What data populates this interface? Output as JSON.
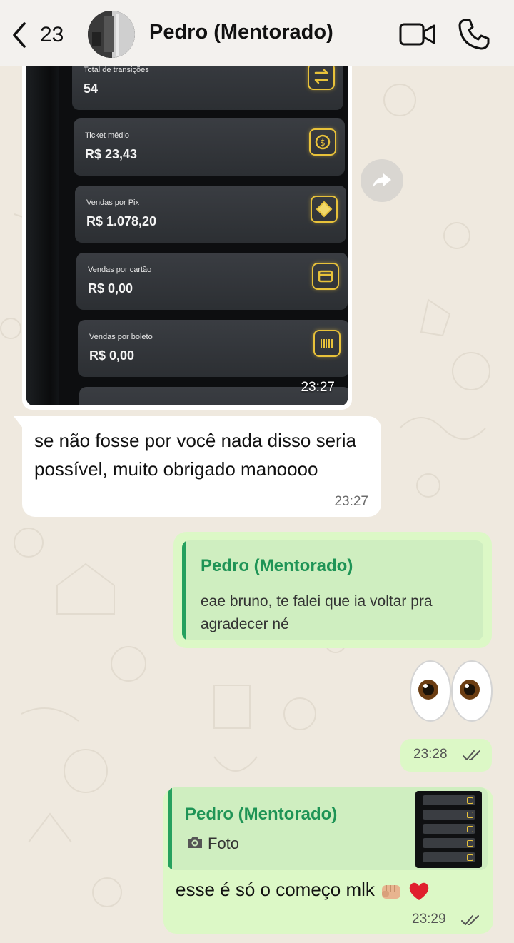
{
  "header": {
    "back_count": "23",
    "title": "Pedro (Mentorado)",
    "icons": [
      "chevron-left-icon",
      "avatar",
      "video-camera-icon",
      "phone-icon"
    ]
  },
  "photo_message": {
    "stats": [
      {
        "label": "Total de transições",
        "value": "54",
        "icon": "swap-arrows-icon"
      },
      {
        "label": "Ticket médio",
        "value": "R$ 23,43",
        "icon": "coin-icon"
      },
      {
        "label": "Vendas por Pix",
        "value": "R$ 1.078,20",
        "icon": "pix-icon"
      },
      {
        "label": "Vendas por cartão",
        "value": "R$ 0,00",
        "icon": "card-icon"
      },
      {
        "label": "Vendas por boleto",
        "value": "R$ 0,00",
        "icon": "barcode-icon"
      }
    ],
    "time": "23:27"
  },
  "incoming_message": {
    "text": "se não fosse por você nada disso seria possível, muito obrigado manoooo",
    "time": "23:27"
  },
  "reply_1": {
    "quoted_name": "Pedro (Mentorado)",
    "quoted_text": "eae bruno, te falei que ia voltar pra agradecer né"
  },
  "emoji_message": {
    "emoji": "eyes",
    "time": "23:28",
    "status": "read"
  },
  "reply_2": {
    "quoted_name": "Pedro (Mentorado)",
    "quoted_text": "Foto",
    "text": "esse é só o começo mlk",
    "emojis": [
      "fist",
      "red-heart"
    ],
    "time": "23:29",
    "status": "read"
  },
  "colors": {
    "outgoing_bubble": "#dcf8c6",
    "incoming_bubble": "#ffffff",
    "quote_accent": "#25a05e",
    "stat_icon_gold": "#e8c23a"
  }
}
